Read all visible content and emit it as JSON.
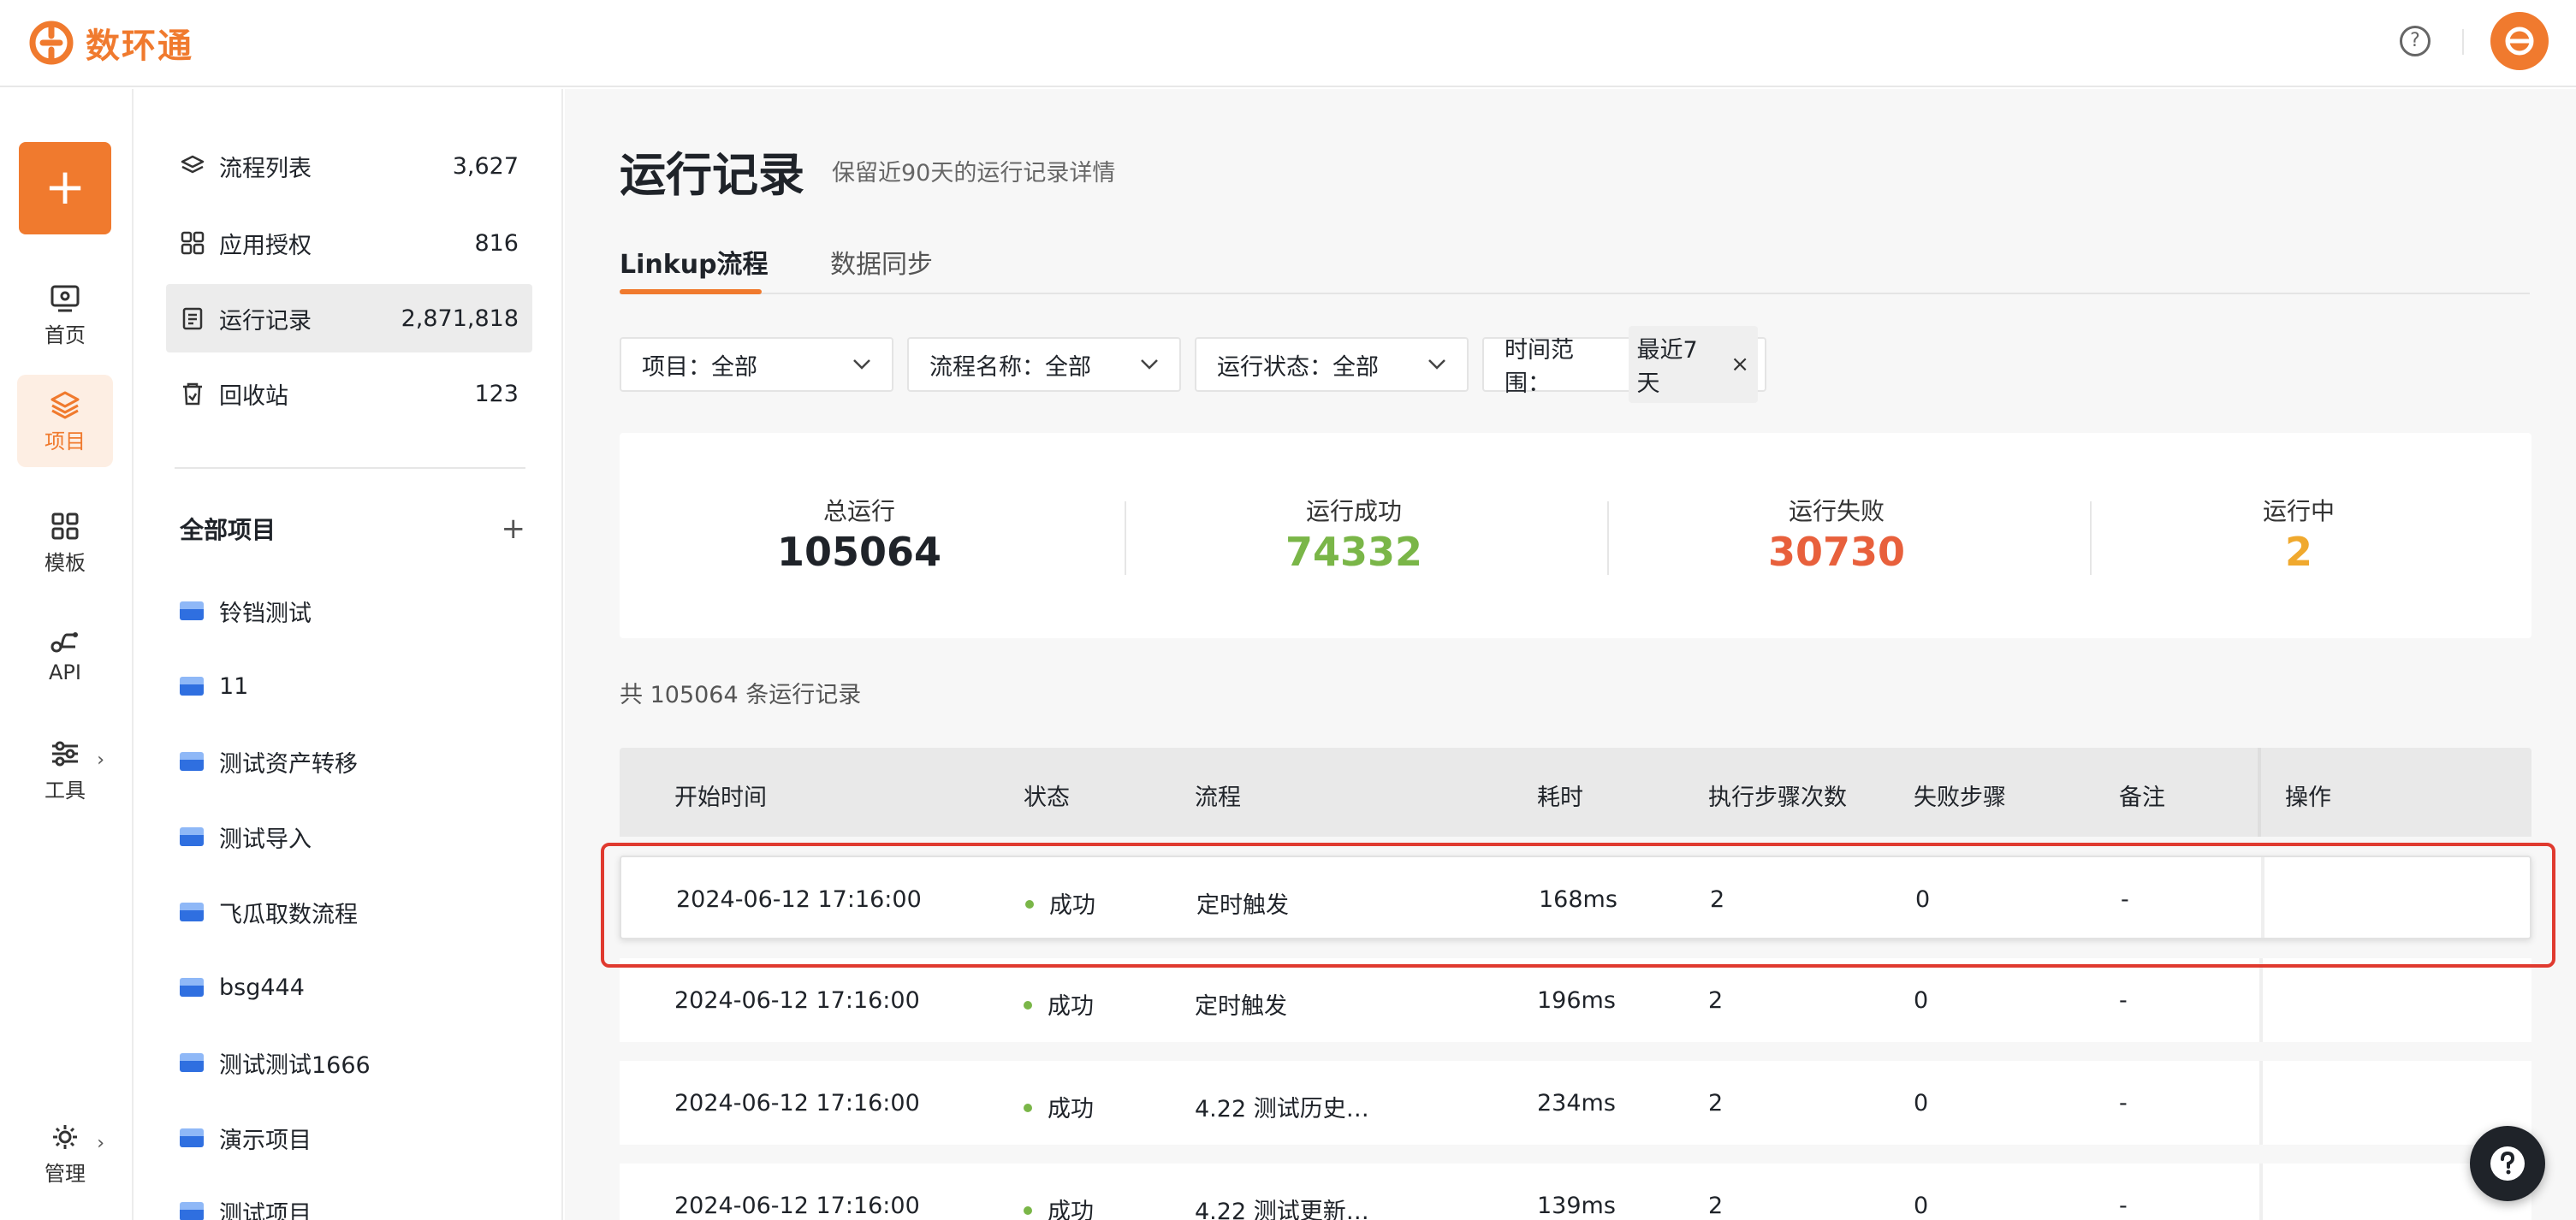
{
  "header": {
    "brand": "数环通",
    "help_glyph": "?"
  },
  "rail": {
    "create_label": "+",
    "items": [
      {
        "label": "首页",
        "icon": "home-monitor-icon"
      },
      {
        "label": "项目",
        "icon": "layers-icon",
        "active": true
      },
      {
        "label": "模板",
        "icon": "grid-icon"
      },
      {
        "label": "API",
        "icon": "api-icon"
      },
      {
        "label": "工具",
        "icon": "sliders-icon"
      },
      {
        "label": "管理",
        "icon": "gear-icon"
      }
    ]
  },
  "sidebar": {
    "nav": [
      {
        "label": "流程列表",
        "count": "3,627",
        "icon": "layers-icon"
      },
      {
        "label": "应用授权",
        "count": "816",
        "icon": "grid-icon"
      },
      {
        "label": "运行记录",
        "count": "2,871,818",
        "icon": "clipboard-icon",
        "active": true
      },
      {
        "label": "回收站",
        "count": "123",
        "icon": "trash-icon"
      }
    ],
    "projects_title": "全部项目",
    "projects_add": "+",
    "projects": [
      "铃铛测试",
      "11",
      "测试资产转移",
      "测试导入",
      "飞瓜取数流程",
      "bsg444",
      "测试测试1666",
      "演示项目",
      "测试项目"
    ]
  },
  "main": {
    "title": "运行记录",
    "subtitle": "保留近90天的运行记录详情",
    "tabs": [
      "Linkup流程",
      "数据同步"
    ],
    "filters": {
      "project": "项目：全部",
      "flow": "流程名称：全部",
      "status": "运行状态：全部",
      "time_label": "时间范围：",
      "time_value": "最近7天"
    },
    "stats": [
      {
        "label": "总运行",
        "value": "105064",
        "color": "#1f2329"
      },
      {
        "label": "运行成功",
        "value": "74332",
        "color": "#7ab648"
      },
      {
        "label": "运行失败",
        "value": "30730",
        "color": "#e8603c"
      },
      {
        "label": "运行中",
        "value": "2",
        "color": "#f0a92e"
      }
    ],
    "total_text": "共 105064 条运行记录",
    "table": {
      "headers": [
        "开始时间",
        "状态",
        "流程",
        "耗时",
        "执行步骤次数",
        "失败步骤",
        "备注",
        "操作"
      ],
      "rows": [
        {
          "start": "2024-06-12 17:16:00",
          "status": "成功",
          "flow": "定时触发",
          "duration": "168ms",
          "steps": "2",
          "failed": "0",
          "note": "-"
        },
        {
          "start": "2024-06-12 17:16:00",
          "status": "成功",
          "flow": "定时触发",
          "duration": "196ms",
          "steps": "2",
          "failed": "0",
          "note": "-"
        },
        {
          "start": "2024-06-12 17:16:00",
          "status": "成功",
          "flow": "4.22 测试历史…",
          "duration": "234ms",
          "steps": "2",
          "failed": "0",
          "note": "-"
        },
        {
          "start": "2024-06-12 17:16:00",
          "status": "成功",
          "flow": "4.22 测试更新…",
          "duration": "139ms",
          "steps": "2",
          "failed": "0",
          "note": "-"
        }
      ]
    }
  }
}
